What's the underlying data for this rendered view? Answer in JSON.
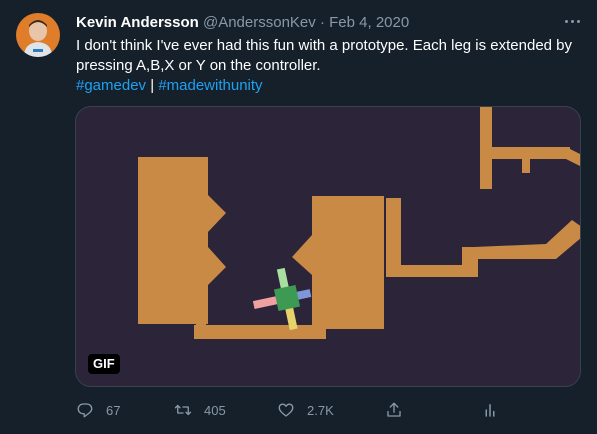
{
  "tweet": {
    "author_name": "Kevin Andersson",
    "handle": "@AnderssonKev",
    "separator": "·",
    "date": "Feb 4, 2020",
    "text": "I don't think I've ever had this fun with a prototype. Each leg is extended by pressing A,B,X or Y on the controller.",
    "hashtags": [
      "#gamedev",
      "#madewithunity"
    ],
    "hashtag_separator": "|"
  },
  "media": {
    "gif_label": "GIF",
    "colors": {
      "background": "#2c2439",
      "terrain": "#c98a45",
      "robot_body": "#3d9a52"
    }
  },
  "actions": {
    "reply_count": "67",
    "retweet_count": "405",
    "like_count": "2.7K"
  },
  "icons": [
    "more-icon",
    "reply-icon",
    "retweet-icon",
    "like-icon",
    "share-icon",
    "analytics-icon"
  ],
  "theme": {
    "background": "#15202b",
    "link": "#1da1f2",
    "muted": "#8899a6"
  }
}
